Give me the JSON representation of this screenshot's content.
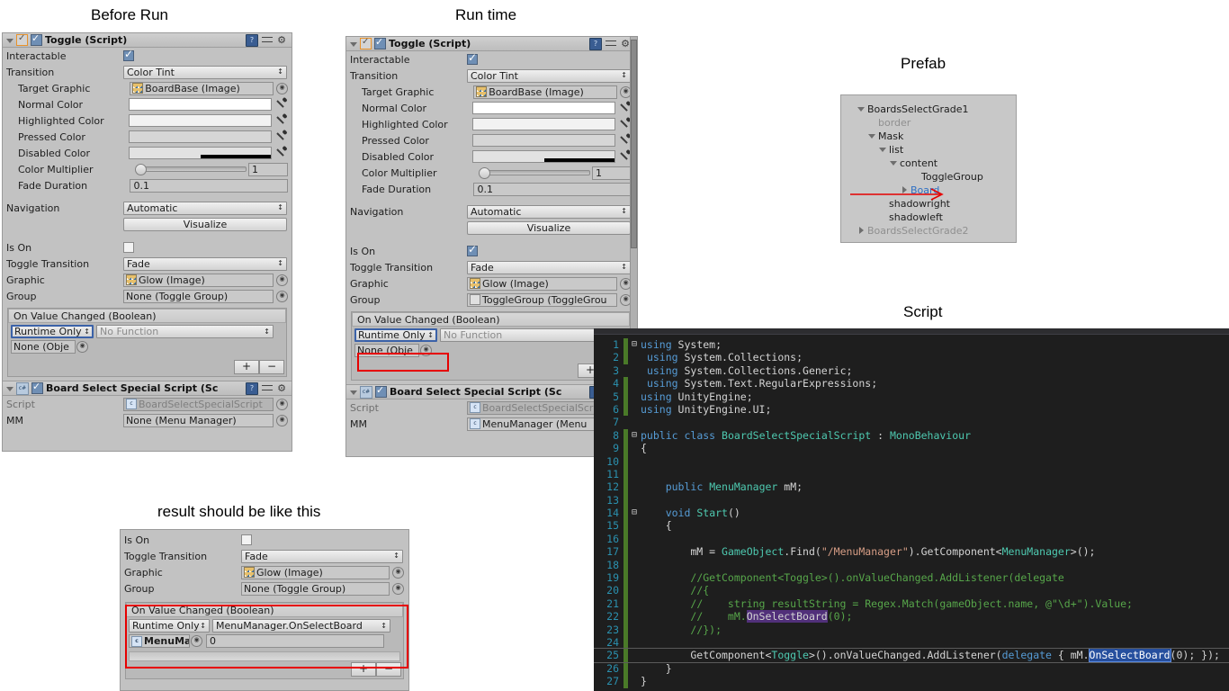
{
  "captions": {
    "before_run": "Before Run",
    "run_time": "Run time",
    "prefab": "Prefab",
    "script": "Script",
    "result": "result should be like this"
  },
  "toggle_component": {
    "title": "Toggle (Script)",
    "labels": {
      "interactable": "Interactable",
      "transition": "Transition",
      "target_graphic": "Target Graphic",
      "normal_color": "Normal Color",
      "highlighted_color": "Highlighted Color",
      "pressed_color": "Pressed Color",
      "disabled_color": "Disabled Color",
      "color_multiplier": "Color Multiplier",
      "fade_duration": "Fade Duration",
      "navigation": "Navigation",
      "visualize": "Visualize",
      "is_on": "Is On",
      "toggle_transition": "Toggle Transition",
      "graphic": "Graphic",
      "group": "Group",
      "on_value_changed": "On Value Changed (Boolean)"
    },
    "values": {
      "transition": "Color Tint",
      "target_graphic": "BoardBase (Image)",
      "color_multiplier": "1",
      "fade_duration": "0.1",
      "navigation": "Automatic",
      "toggle_transition": "Fade",
      "graphic": "Glow (Image)",
      "group_none": "None (Toggle Group)",
      "group_set": "ToggleGroup (ToggleGrou",
      "runtime_only": "Runtime Only",
      "no_function": "No Function",
      "none_object": "None (Obje",
      "function_set": "MenuManager.OnSelectBoard",
      "object_set": "MenuMa",
      "arg_value": "0",
      "plus": "+",
      "minus": "−"
    }
  },
  "script_component": {
    "title": "Board Select Special Script (Sc",
    "labels": {
      "script": "Script",
      "mm": "MM"
    },
    "values": {
      "script": "BoardSelectSpecialScript",
      "mm_none": "None (Menu Manager)",
      "mm_set": "MenuManager (Menu"
    }
  },
  "prefab_tree": [
    {
      "label": "BoardsSelectGrade1",
      "indent": 1,
      "tri": "open",
      "style": "normal"
    },
    {
      "label": "border",
      "indent": 2,
      "tri": "none",
      "style": "dim"
    },
    {
      "label": "Mask",
      "indent": 2,
      "tri": "open",
      "style": "normal"
    },
    {
      "label": "list",
      "indent": 3,
      "tri": "open",
      "style": "normal"
    },
    {
      "label": "content",
      "indent": 4,
      "tri": "open",
      "style": "normal"
    },
    {
      "label": "ToggleGroup",
      "indent": 6,
      "tri": "none",
      "style": "normal"
    },
    {
      "label": "Board",
      "indent": 5,
      "tri": "closed",
      "style": "blue"
    },
    {
      "label": "shadowright",
      "indent": 3,
      "tri": "none",
      "style": "normal"
    },
    {
      "label": "shadowleft",
      "indent": 3,
      "tri": "none",
      "style": "normal"
    },
    {
      "label": "BoardsSelectGrade2",
      "indent": 1,
      "tri": "closed",
      "style": "dim"
    }
  ],
  "code": {
    "lines": [
      {
        "n": "1",
        "fold": "⊟",
        "bar": "green",
        "html": "<span class='kw'>using</span> System;"
      },
      {
        "n": "2",
        "fold": "",
        "bar": "green",
        "html": " <span class='kw'>using</span> System.Collections;"
      },
      {
        "n": "3",
        "fold": "",
        "bar": "none",
        "html": " <span class='kw'>using</span> System.Collections.Generic;"
      },
      {
        "n": "4",
        "fold": "",
        "bar": "green",
        "html": " <span class='kw'>using</span> System.Text.RegularExpressions;"
      },
      {
        "n": "5",
        "fold": "",
        "bar": "green",
        "html": "<span class='kw'>using</span> UnityEngine;"
      },
      {
        "n": "6",
        "fold": "",
        "bar": "green",
        "html": "<span class='kw'>using</span> UnityEngine.UI;"
      },
      {
        "n": "7",
        "fold": "",
        "bar": "none",
        "html": ""
      },
      {
        "n": "8",
        "fold": "⊟",
        "bar": "green",
        "html": "<span class='kw'>public</span> <span class='kw'>class</span> <span class='typ'>BoardSelectSpecialScript</span> : <span class='typ'>MonoBehaviour</span>"
      },
      {
        "n": "9",
        "fold": "",
        "bar": "green",
        "html": "{"
      },
      {
        "n": "10",
        "fold": "",
        "bar": "green",
        "html": ""
      },
      {
        "n": "11",
        "fold": "",
        "bar": "green",
        "html": ""
      },
      {
        "n": "12",
        "fold": "",
        "bar": "green",
        "html": "    <span class='kw'>public</span> <span class='typ'>MenuManager</span> mM;"
      },
      {
        "n": "13",
        "fold": "",
        "bar": "green",
        "html": ""
      },
      {
        "n": "14",
        "fold": "⊟",
        "bar": "green",
        "html": "    <span class='kw'>void</span> <span class='typ'>Start</span>()"
      },
      {
        "n": "15",
        "fold": "",
        "bar": "green",
        "html": "    {"
      },
      {
        "n": "16",
        "fold": "",
        "bar": "green",
        "html": ""
      },
      {
        "n": "17",
        "fold": "",
        "bar": "green",
        "html": "        mM = <span class='typ'>GameObject</span>.Find(<span class='str'>\"/MenuManager\"</span>).GetComponent&lt;<span class='typ'>MenuManager</span>&gt;();"
      },
      {
        "n": "18",
        "fold": "",
        "bar": "green",
        "html": ""
      },
      {
        "n": "19",
        "fold": "",
        "bar": "green",
        "html": "        <span class='cmt'>//GetComponent&lt;Toggle&gt;().onValueChanged.AddListener(delegate</span>"
      },
      {
        "n": "20",
        "fold": "",
        "bar": "green",
        "html": "        <span class='cmt'>//{</span>"
      },
      {
        "n": "21",
        "fold": "",
        "bar": "green",
        "html": "        <span class='cmt'>//    string resultString = Regex.Match(gameObject.name, @\"\\d+\").Value;</span>"
      },
      {
        "n": "22",
        "fold": "",
        "bar": "green",
        "html": "        <span class='cmt'>//    mM.</span><span class='hl-purple'>OnSelectBoard</span><span class='cmt'>(0);</span>"
      },
      {
        "n": "23",
        "fold": "",
        "bar": "green",
        "html": "        <span class='cmt'>//});</span>"
      },
      {
        "n": "24",
        "fold": "",
        "bar": "green",
        "html": ""
      },
      {
        "n": "25",
        "fold": "",
        "bar": "green",
        "html": "        GetComponent&lt;<span class='typ'>Toggle</span>&gt;().onValueChanged.AddListener(<span class='kw'>delegate</span> { mM.<span class='hl-blue'>OnSelectBoard</span>(0); });"
      },
      {
        "n": "26",
        "fold": "",
        "bar": "green",
        "html": "    }"
      },
      {
        "n": "27",
        "fold": "",
        "bar": "green",
        "html": "}"
      }
    ]
  },
  "colors": {
    "inspector_bg": "#c2c2c2",
    "code_bg": "#1e1e1e",
    "accent_red": "#e60000",
    "link_blue": "#2e6fc4",
    "line_number": "#2b91af"
  }
}
